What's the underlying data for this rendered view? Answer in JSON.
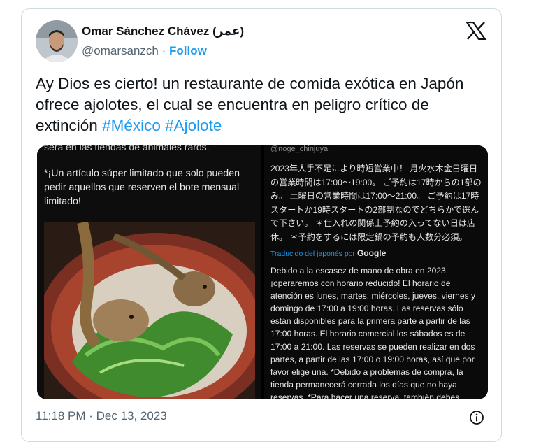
{
  "author": {
    "name": "Omar Sánchez Chávez (عمر)",
    "handle": "@omarsanzch",
    "separator": "·",
    "follow_label": "Follow"
  },
  "tweet": {
    "text": "Ay Dios es cierto! un restaurante de comida exótica en Japón ofrece ajolotes, el cual se encuentra en peligro crítico de extinción ",
    "hashtag1": "#México",
    "hashtag2": "#Ajolote"
  },
  "media": {
    "left": {
      "cut_text": "será en las tiendas de animales raros.",
      "caption": "*¡Un artículo súper limitado que solo pueden pedir aquellos que reserven el bote mensual limitado!"
    },
    "right": {
      "handle": "@noge_chinjuya",
      "japanese": "2023年人手不足により時短営業中！ 月火水木金日曜日の営業時間は17:00〜19:00。 ご予約は17時からの1部のみ。 土曜日の営業時間は17:00〜21:00。 ご予約は17時スタートか19時スタートの2部制なのでどちらかで選んで下さい。 ＊仕入れの関係上予約の入ってない日は店休。 ＊予約をするには限定鍋の予約も人数分必須。",
      "translated_prefix": "Traducido del japonés por ",
      "translated_brand": "Google",
      "spanish": "Debido a la escasez de mano de obra en 2023, ¡operaremos con horario reducido! El horario de atención es lunes, martes, miércoles, jueves, viernes y domingo de 17:00 a 19:00 horas. Las reservas sólo están disponibles para la primera parte a partir de las 17:00 horas. El horario comercial los sábados es de 17:00 a 21:00. Las reservas se pueden realizar en dos partes, a partir de las 17:00 o 19:00 horas, así que por favor elige una. *Debido a problemas de compra, la tienda permanecerá cerrada los días que no haya reservas. *Para hacer una reserva, también debes"
    }
  },
  "footer": {
    "timestamp": "11:18 PM · Dec 13, 2023"
  },
  "colors": {
    "accent": "#1d9bf0",
    "text": "#0f1419",
    "muted": "#536471",
    "border": "#cfd9de"
  },
  "icons": [
    "x-logo-icon",
    "info-icon"
  ]
}
